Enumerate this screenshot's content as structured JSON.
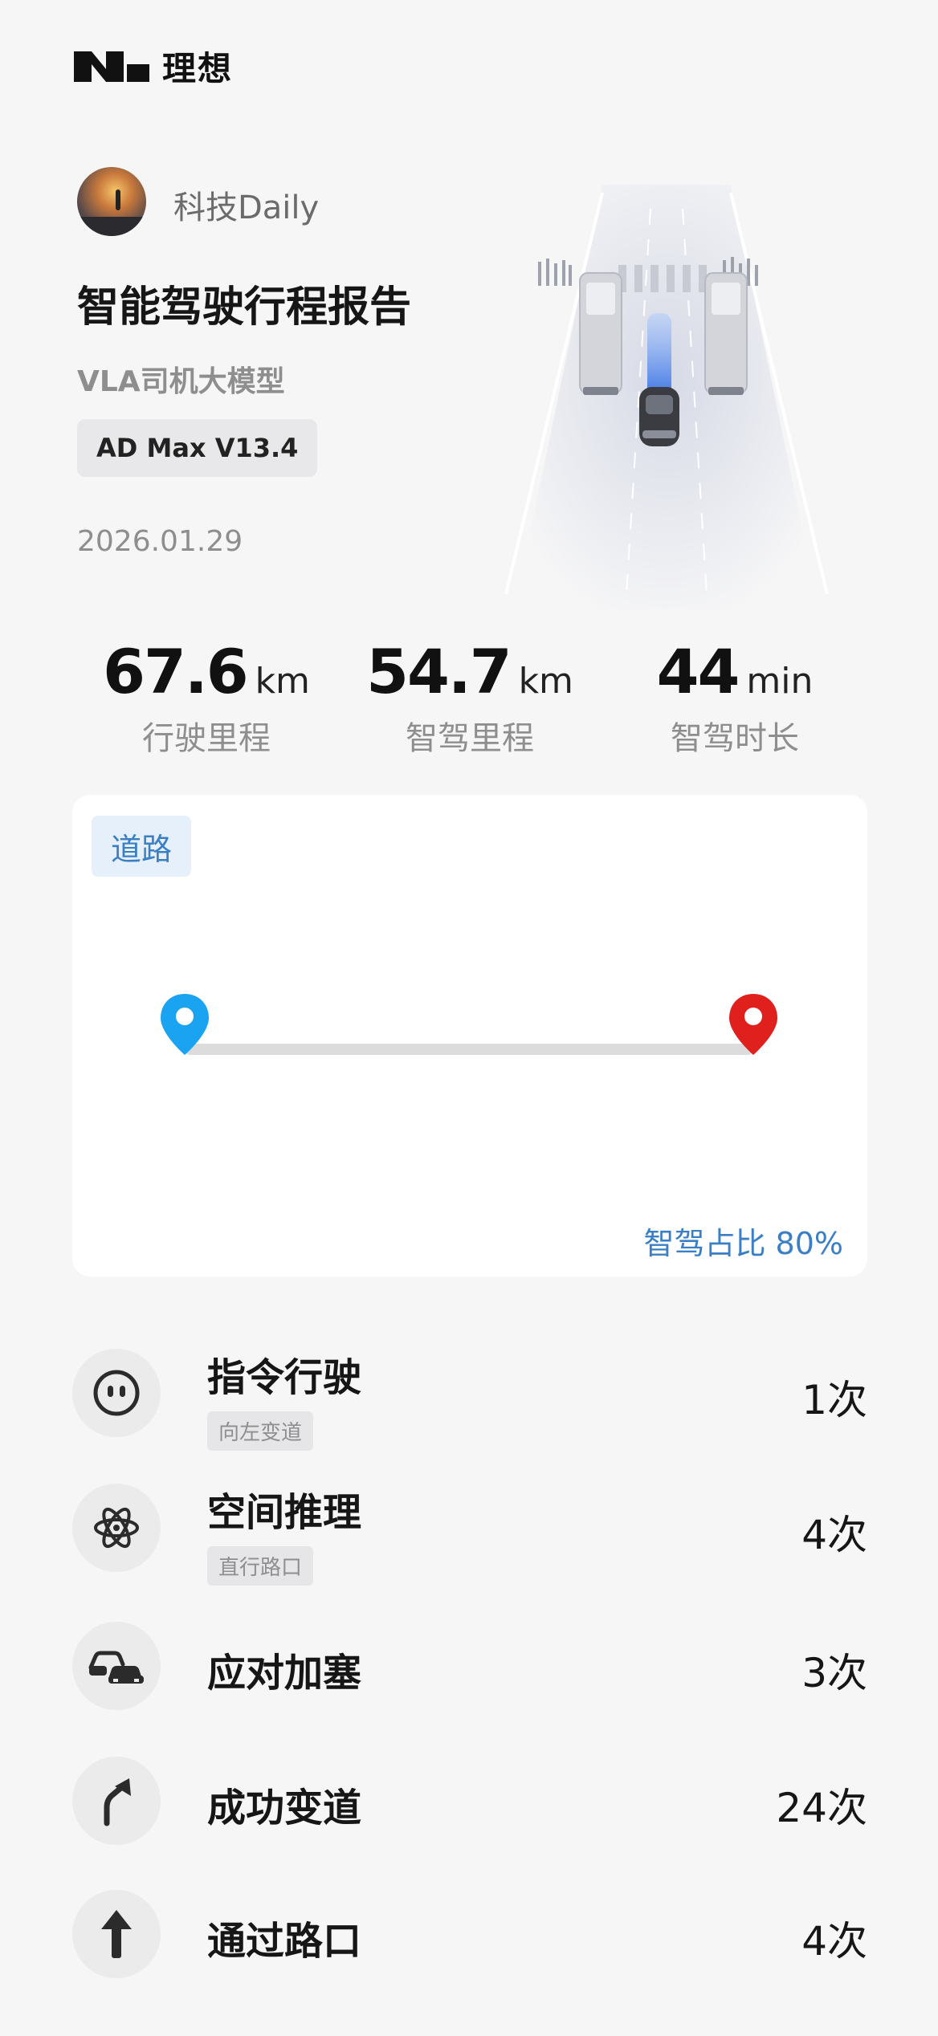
{
  "brand": {
    "name": "理想"
  },
  "profile": {
    "username": "科技Daily"
  },
  "report": {
    "title": "智能驾驶行程报告",
    "subtitle": "VLA司机大模型",
    "version": "AD Max V13.4",
    "date": "2026.01.29"
  },
  "stats": [
    {
      "value": "67.6",
      "unit": "km",
      "label": "行驶里程"
    },
    {
      "value": "54.7",
      "unit": "km",
      "label": "智驾里程"
    },
    {
      "value": "44",
      "unit": "min",
      "label": "智驾时长"
    }
  ],
  "road_card": {
    "tab": "道路",
    "ratio_text": "智驾占比 80%",
    "autodrive_ratio": 0.8
  },
  "events": [
    {
      "name": "指令行驶",
      "sub": "向左变道",
      "count": "1次",
      "icon": "face-icon"
    },
    {
      "name": "空间推理",
      "sub": "直行路口",
      "count": "4次",
      "icon": "atom-icon"
    },
    {
      "name": "应对加塞",
      "sub": "",
      "count": "3次",
      "icon": "cars-icon"
    },
    {
      "name": "成功变道",
      "sub": "",
      "count": "24次",
      "icon": "lane-change-icon"
    },
    {
      "name": "通过路口",
      "sub": "",
      "count": "4次",
      "icon": "straight-arrow-icon"
    }
  ],
  "colors": {
    "accent_blue": "#3a7fc6",
    "start_pin": "#1aa3f0",
    "end_pin": "#e0201c"
  }
}
